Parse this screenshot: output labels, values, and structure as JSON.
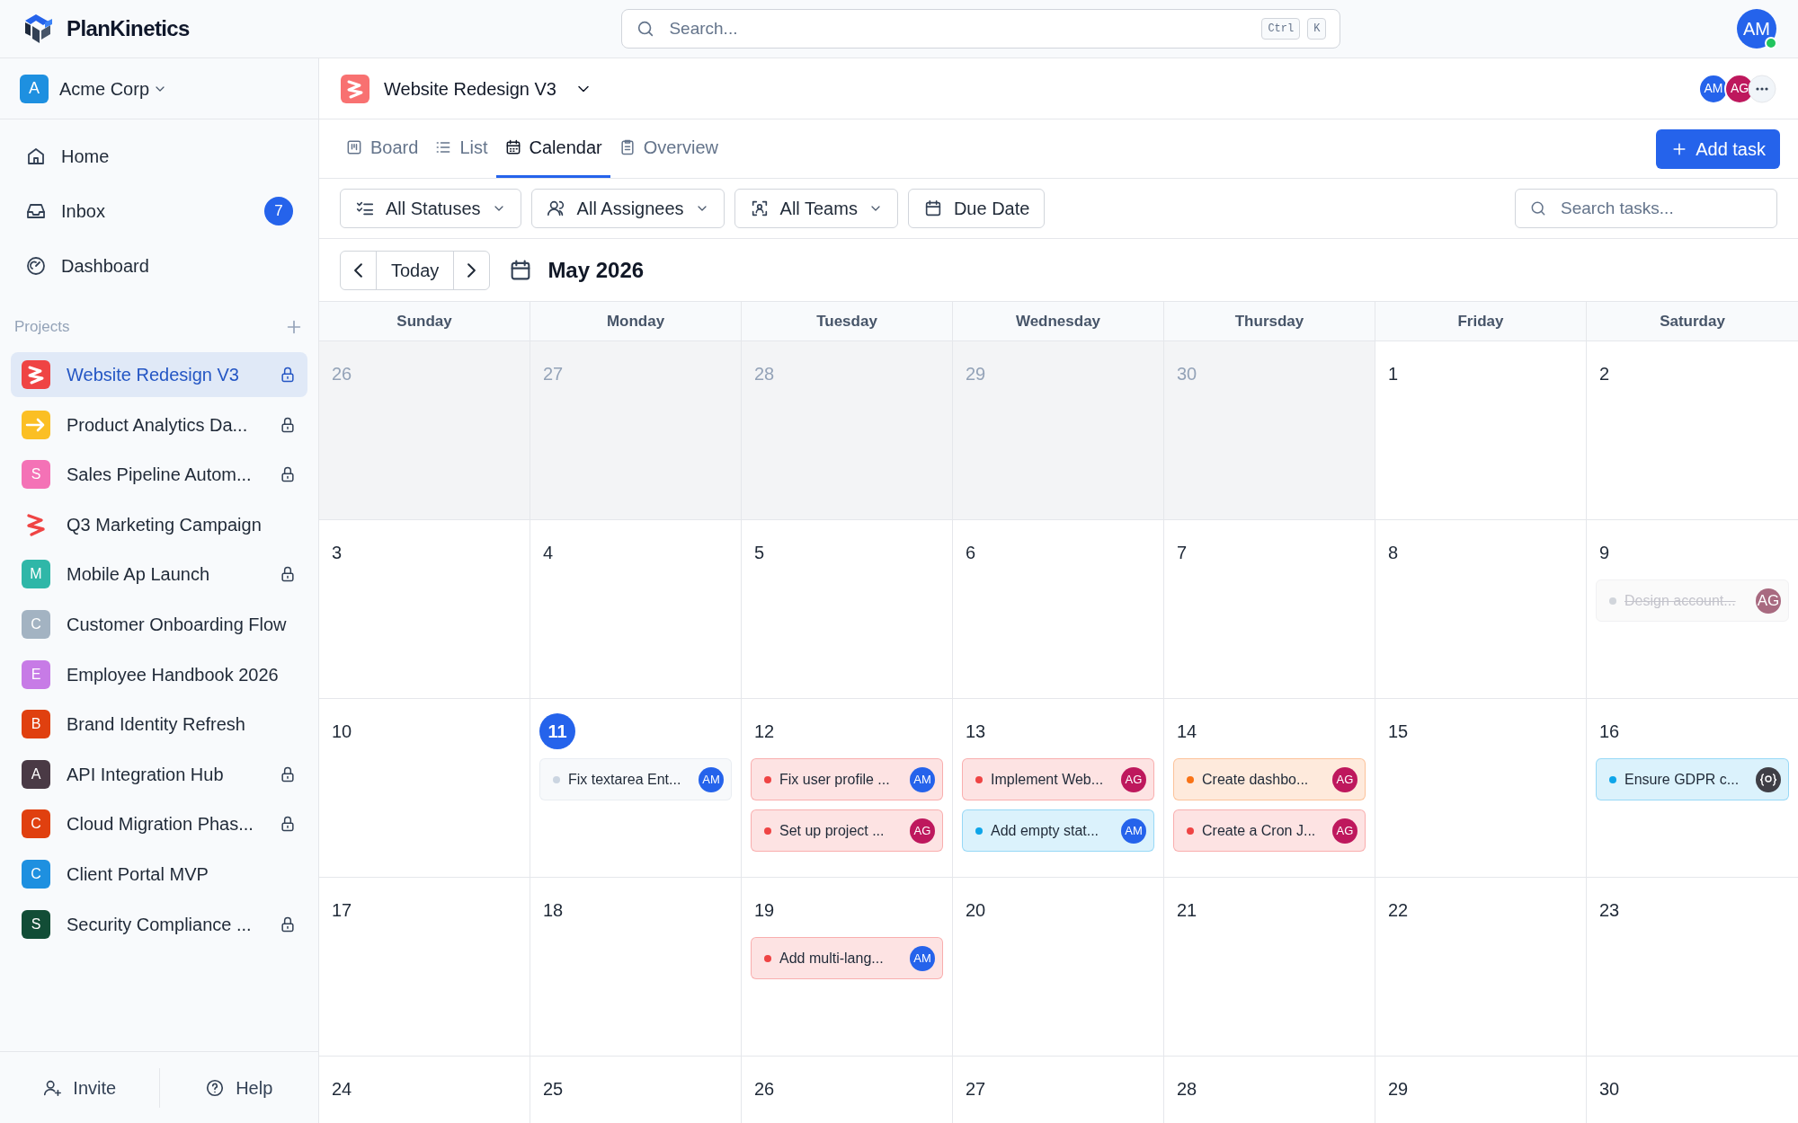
{
  "app": {
    "name": "PlanKinetics",
    "search": {
      "placeholder": "Search...",
      "keys": [
        "Ctrl",
        "K"
      ]
    },
    "user": {
      "initials": "AM",
      "online": true
    }
  },
  "sidebar": {
    "workspace": {
      "letter": "A",
      "name": "Acme Corp"
    },
    "nav": [
      {
        "kind": "home",
        "label": "Home",
        "selected": false
      },
      {
        "kind": "inbox",
        "label": "Inbox",
        "badge": "7",
        "selected": false
      },
      {
        "kind": "dashboard",
        "label": "Dashboard",
        "selected": false
      }
    ],
    "projects_label": "Projects",
    "projects": [
      {
        "name": "Website Redesign V3",
        "kind": "logo",
        "locked": true,
        "selected": true
      },
      {
        "name": "Product Analytics Da...",
        "kind": "arrow",
        "color": "#fbbf24",
        "locked": true,
        "selected": false
      },
      {
        "name": "Sales Pipeline Autom...",
        "kind": "letter",
        "letter": "S",
        "color": "#f472b6",
        "locked": true,
        "selected": false
      },
      {
        "name": "Q3 Marketing Campaign",
        "kind": "zigzag",
        "locked": false,
        "selected": false
      },
      {
        "name": "Mobile Ap Launch",
        "kind": "letter",
        "letter": "M",
        "color": "#2fb7a8",
        "locked": true,
        "selected": false
      },
      {
        "name": "Customer Onboarding Flow",
        "kind": "letter",
        "letter": "C",
        "color": "#a3b3c2",
        "locked": false,
        "selected": false
      },
      {
        "name": "Employee Handbook 2026",
        "kind": "letter",
        "letter": "E",
        "color": "#c77be6",
        "locked": false,
        "selected": false
      },
      {
        "name": "Brand Identity Refresh",
        "kind": "letter",
        "letter": "B",
        "color": "#e0400f",
        "locked": false,
        "selected": false
      },
      {
        "name": "API Integration Hub",
        "kind": "letter",
        "letter": "A",
        "color": "#4a3a45",
        "locked": true,
        "selected": false
      },
      {
        "name": "Cloud Migration Phas...",
        "kind": "letter",
        "letter": "C",
        "color": "#e0400f",
        "locked": true,
        "selected": false
      },
      {
        "name": "Client Portal MVP",
        "kind": "letter",
        "letter": "C",
        "color": "#1e90e0",
        "locked": false,
        "selected": false
      },
      {
        "name": "Security Compliance ...",
        "kind": "letter",
        "letter": "S",
        "color": "#124d36",
        "locked": true,
        "selected": false
      }
    ],
    "footer": [
      {
        "kind": "invite",
        "label": "Invite"
      },
      {
        "kind": "help",
        "label": "Help"
      }
    ]
  },
  "project_header": {
    "title": "Website Redesign V3",
    "members": [
      {
        "initials": "AM",
        "color": "#2563eb"
      },
      {
        "initials": "AG",
        "color": "#be185d"
      }
    ]
  },
  "tabs": [
    {
      "kind": "board",
      "label": "Board",
      "selected": false
    },
    {
      "kind": "list",
      "label": "List",
      "selected": false
    },
    {
      "kind": "calendar",
      "label": "Calendar",
      "selected": true
    },
    {
      "kind": "overview",
      "label": "Overview",
      "selected": false
    }
  ],
  "add_task": "Add task",
  "filters": [
    {
      "kind": "status",
      "label": "All Statuses",
      "dropdown": true
    },
    {
      "kind": "assignee",
      "label": "All Assignees",
      "dropdown": true
    },
    {
      "kind": "team",
      "label": "All Teams",
      "dropdown": true
    },
    {
      "kind": "date",
      "label": "Due Date",
      "dropdown": false
    }
  ],
  "task_search": {
    "placeholder": "Search tasks..."
  },
  "calendar": {
    "today_label": "Today",
    "month": "May 2026",
    "weekdays": [
      "Sunday",
      "Monday",
      "Tuesday",
      "Wednesday",
      "Thursday",
      "Friday",
      "Saturday"
    ],
    "weeks": [
      [
        {
          "day": "26",
          "muted": true
        },
        {
          "day": "27",
          "muted": true
        },
        {
          "day": "28",
          "muted": true
        },
        {
          "day": "29",
          "muted": true
        },
        {
          "day": "30",
          "muted": true
        },
        {
          "day": "1",
          "muted": false
        },
        {
          "day": "2",
          "muted": false
        }
      ],
      [
        {
          "day": "3",
          "muted": false
        },
        {
          "day": "4",
          "muted": false
        },
        {
          "day": "5",
          "muted": false
        },
        {
          "day": "6",
          "muted": false
        },
        {
          "day": "7",
          "muted": false
        },
        {
          "day": "8",
          "muted": false
        },
        {
          "day": "9",
          "muted": false,
          "events": [
            {
              "title": "Design account...",
              "color": "#d1d5db",
              "done": true,
              "assignee": {
                "kind": "initials",
                "initials": "AG",
                "color": "#a86a80"
              }
            }
          ]
        }
      ],
      [
        {
          "day": "10",
          "muted": false
        },
        {
          "day": "11",
          "muted": false,
          "today": true,
          "events": [
            {
              "title": "Fix textarea Ent...",
              "color": "#cbd5e1",
              "done": false,
              "assignee": {
                "kind": "initials",
                "initials": "AM",
                "color": "#2563eb"
              }
            }
          ]
        },
        {
          "day": "12",
          "muted": false,
          "events": [
            {
              "title": "Fix user profile ...",
              "color": "#ef4444",
              "done": false,
              "assignee": {
                "kind": "initials",
                "initials": "AM",
                "color": "#2563eb"
              }
            },
            {
              "title": "Set up project ...",
              "color": "#ef4444",
              "done": false,
              "assignee": {
                "kind": "initials",
                "initials": "AG",
                "color": "#be185d"
              }
            }
          ]
        },
        {
          "day": "13",
          "muted": false,
          "events": [
            {
              "title": "Implement Web...",
              "color": "#ef4444",
              "done": false,
              "assignee": {
                "kind": "initials",
                "initials": "AG",
                "color": "#be185d"
              }
            },
            {
              "title": "Add empty stat...",
              "color": "#0ea5e9",
              "done": false,
              "assignee": {
                "kind": "initials",
                "initials": "AM",
                "color": "#2563eb"
              }
            }
          ]
        },
        {
          "day": "14",
          "muted": false,
          "events": [
            {
              "title": "Create dashbo...",
              "color": "#f97316",
              "done": false,
              "assignee": {
                "kind": "initials",
                "initials": "AG",
                "color": "#be185d"
              }
            },
            {
              "title": "Create a Cron J...",
              "color": "#ef4444",
              "done": false,
              "assignee": {
                "kind": "initials",
                "initials": "AG",
                "color": "#be185d"
              }
            }
          ]
        },
        {
          "day": "15",
          "muted": false
        },
        {
          "day": "16",
          "muted": false,
          "events": [
            {
              "title": "Ensure GDPR c...",
              "color": "#0ea5e9",
              "done": false,
              "assignee": {
                "kind": "bot",
                "color": "#3f3f46"
              }
            }
          ]
        }
      ],
      [
        {
          "day": "17",
          "muted": false
        },
        {
          "day": "18",
          "muted": false
        },
        {
          "day": "19",
          "muted": false,
          "events": [
            {
              "title": "Add multi-lang...",
              "color": "#ef4444",
              "done": false,
              "assignee": {
                "kind": "initials",
                "initials": "AM",
                "color": "#2563eb"
              }
            }
          ]
        },
        {
          "day": "20",
          "muted": false
        },
        {
          "day": "21",
          "muted": false
        },
        {
          "day": "22",
          "muted": false
        },
        {
          "day": "23",
          "muted": false
        }
      ],
      [
        {
          "day": "24",
          "muted": false
        },
        {
          "day": "25",
          "muted": false
        },
        {
          "day": "26",
          "muted": false
        },
        {
          "day": "27",
          "muted": false
        },
        {
          "day": "28",
          "muted": false
        },
        {
          "day": "29",
          "muted": false
        },
        {
          "day": "30",
          "muted": false
        }
      ]
    ]
  }
}
